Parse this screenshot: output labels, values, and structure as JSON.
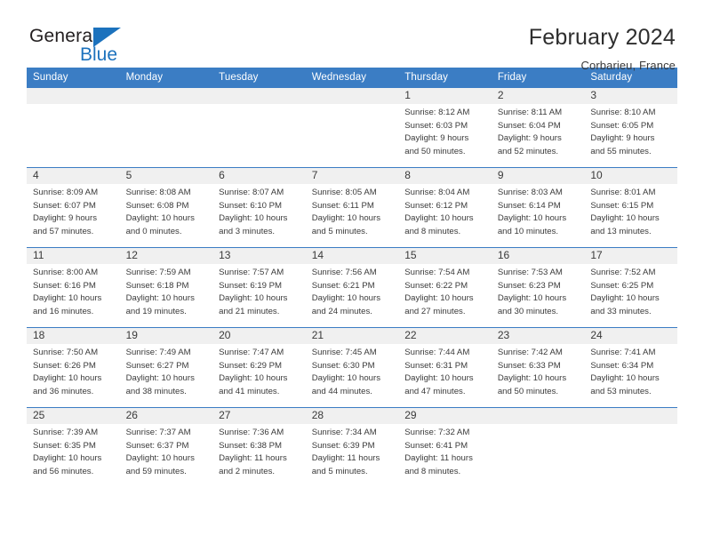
{
  "logo": {
    "word_general": "General",
    "word_blue": "Blue",
    "triangle": "blue-triangle",
    "brand_color": "#1c72bd"
  },
  "header": {
    "title": "February 2024",
    "location": "Corbarieu, France"
  },
  "theme": {
    "header_blue": "#3b7dc4",
    "daynum_band": "#f0f0f0",
    "text": "#3a3a3a"
  },
  "weekdays": [
    "Sunday",
    "Monday",
    "Tuesday",
    "Wednesday",
    "Thursday",
    "Friday",
    "Saturday"
  ],
  "weeks": [
    [
      {
        "day": "",
        "empty": true,
        "sunrise": "",
        "sunset": "",
        "daylight1": "",
        "daylight2": ""
      },
      {
        "day": "",
        "empty": true,
        "sunrise": "",
        "sunset": "",
        "daylight1": "",
        "daylight2": ""
      },
      {
        "day": "",
        "empty": true,
        "sunrise": "",
        "sunset": "",
        "daylight1": "",
        "daylight2": ""
      },
      {
        "day": "",
        "empty": true,
        "sunrise": "",
        "sunset": "",
        "daylight1": "",
        "daylight2": ""
      },
      {
        "day": "1",
        "empty": false,
        "sunrise": "Sunrise: 8:12 AM",
        "sunset": "Sunset: 6:03 PM",
        "daylight1": "Daylight: 9 hours",
        "daylight2": "and 50 minutes."
      },
      {
        "day": "2",
        "empty": false,
        "sunrise": "Sunrise: 8:11 AM",
        "sunset": "Sunset: 6:04 PM",
        "daylight1": "Daylight: 9 hours",
        "daylight2": "and 52 minutes."
      },
      {
        "day": "3",
        "empty": false,
        "sunrise": "Sunrise: 8:10 AM",
        "sunset": "Sunset: 6:05 PM",
        "daylight1": "Daylight: 9 hours",
        "daylight2": "and 55 minutes."
      }
    ],
    [
      {
        "day": "4",
        "empty": false,
        "sunrise": "Sunrise: 8:09 AM",
        "sunset": "Sunset: 6:07 PM",
        "daylight1": "Daylight: 9 hours",
        "daylight2": "and 57 minutes."
      },
      {
        "day": "5",
        "empty": false,
        "sunrise": "Sunrise: 8:08 AM",
        "sunset": "Sunset: 6:08 PM",
        "daylight1": "Daylight: 10 hours",
        "daylight2": "and 0 minutes."
      },
      {
        "day": "6",
        "empty": false,
        "sunrise": "Sunrise: 8:07 AM",
        "sunset": "Sunset: 6:10 PM",
        "daylight1": "Daylight: 10 hours",
        "daylight2": "and 3 minutes."
      },
      {
        "day": "7",
        "empty": false,
        "sunrise": "Sunrise: 8:05 AM",
        "sunset": "Sunset: 6:11 PM",
        "daylight1": "Daylight: 10 hours",
        "daylight2": "and 5 minutes."
      },
      {
        "day": "8",
        "empty": false,
        "sunrise": "Sunrise: 8:04 AM",
        "sunset": "Sunset: 6:12 PM",
        "daylight1": "Daylight: 10 hours",
        "daylight2": "and 8 minutes."
      },
      {
        "day": "9",
        "empty": false,
        "sunrise": "Sunrise: 8:03 AM",
        "sunset": "Sunset: 6:14 PM",
        "daylight1": "Daylight: 10 hours",
        "daylight2": "and 10 minutes."
      },
      {
        "day": "10",
        "empty": false,
        "sunrise": "Sunrise: 8:01 AM",
        "sunset": "Sunset: 6:15 PM",
        "daylight1": "Daylight: 10 hours",
        "daylight2": "and 13 minutes."
      }
    ],
    [
      {
        "day": "11",
        "empty": false,
        "sunrise": "Sunrise: 8:00 AM",
        "sunset": "Sunset: 6:16 PM",
        "daylight1": "Daylight: 10 hours",
        "daylight2": "and 16 minutes."
      },
      {
        "day": "12",
        "empty": false,
        "sunrise": "Sunrise: 7:59 AM",
        "sunset": "Sunset: 6:18 PM",
        "daylight1": "Daylight: 10 hours",
        "daylight2": "and 19 minutes."
      },
      {
        "day": "13",
        "empty": false,
        "sunrise": "Sunrise: 7:57 AM",
        "sunset": "Sunset: 6:19 PM",
        "daylight1": "Daylight: 10 hours",
        "daylight2": "and 21 minutes."
      },
      {
        "day": "14",
        "empty": false,
        "sunrise": "Sunrise: 7:56 AM",
        "sunset": "Sunset: 6:21 PM",
        "daylight1": "Daylight: 10 hours",
        "daylight2": "and 24 minutes."
      },
      {
        "day": "15",
        "empty": false,
        "sunrise": "Sunrise: 7:54 AM",
        "sunset": "Sunset: 6:22 PM",
        "daylight1": "Daylight: 10 hours",
        "daylight2": "and 27 minutes."
      },
      {
        "day": "16",
        "empty": false,
        "sunrise": "Sunrise: 7:53 AM",
        "sunset": "Sunset: 6:23 PM",
        "daylight1": "Daylight: 10 hours",
        "daylight2": "and 30 minutes."
      },
      {
        "day": "17",
        "empty": false,
        "sunrise": "Sunrise: 7:52 AM",
        "sunset": "Sunset: 6:25 PM",
        "daylight1": "Daylight: 10 hours",
        "daylight2": "and 33 minutes."
      }
    ],
    [
      {
        "day": "18",
        "empty": false,
        "sunrise": "Sunrise: 7:50 AM",
        "sunset": "Sunset: 6:26 PM",
        "daylight1": "Daylight: 10 hours",
        "daylight2": "and 36 minutes."
      },
      {
        "day": "19",
        "empty": false,
        "sunrise": "Sunrise: 7:49 AM",
        "sunset": "Sunset: 6:27 PM",
        "daylight1": "Daylight: 10 hours",
        "daylight2": "and 38 minutes."
      },
      {
        "day": "20",
        "empty": false,
        "sunrise": "Sunrise: 7:47 AM",
        "sunset": "Sunset: 6:29 PM",
        "daylight1": "Daylight: 10 hours",
        "daylight2": "and 41 minutes."
      },
      {
        "day": "21",
        "empty": false,
        "sunrise": "Sunrise: 7:45 AM",
        "sunset": "Sunset: 6:30 PM",
        "daylight1": "Daylight: 10 hours",
        "daylight2": "and 44 minutes."
      },
      {
        "day": "22",
        "empty": false,
        "sunrise": "Sunrise: 7:44 AM",
        "sunset": "Sunset: 6:31 PM",
        "daylight1": "Daylight: 10 hours",
        "daylight2": "and 47 minutes."
      },
      {
        "day": "23",
        "empty": false,
        "sunrise": "Sunrise: 7:42 AM",
        "sunset": "Sunset: 6:33 PM",
        "daylight1": "Daylight: 10 hours",
        "daylight2": "and 50 minutes."
      },
      {
        "day": "24",
        "empty": false,
        "sunrise": "Sunrise: 7:41 AM",
        "sunset": "Sunset: 6:34 PM",
        "daylight1": "Daylight: 10 hours",
        "daylight2": "and 53 minutes."
      }
    ],
    [
      {
        "day": "25",
        "empty": false,
        "sunrise": "Sunrise: 7:39 AM",
        "sunset": "Sunset: 6:35 PM",
        "daylight1": "Daylight: 10 hours",
        "daylight2": "and 56 minutes."
      },
      {
        "day": "26",
        "empty": false,
        "sunrise": "Sunrise: 7:37 AM",
        "sunset": "Sunset: 6:37 PM",
        "daylight1": "Daylight: 10 hours",
        "daylight2": "and 59 minutes."
      },
      {
        "day": "27",
        "empty": false,
        "sunrise": "Sunrise: 7:36 AM",
        "sunset": "Sunset: 6:38 PM",
        "daylight1": "Daylight: 11 hours",
        "daylight2": "and 2 minutes."
      },
      {
        "day": "28",
        "empty": false,
        "sunrise": "Sunrise: 7:34 AM",
        "sunset": "Sunset: 6:39 PM",
        "daylight1": "Daylight: 11 hours",
        "daylight2": "and 5 minutes."
      },
      {
        "day": "29",
        "empty": false,
        "sunrise": "Sunrise: 7:32 AM",
        "sunset": "Sunset: 6:41 PM",
        "daylight1": "Daylight: 11 hours",
        "daylight2": "and 8 minutes."
      },
      {
        "day": "",
        "empty": true,
        "sunrise": "",
        "sunset": "",
        "daylight1": "",
        "daylight2": ""
      },
      {
        "day": "",
        "empty": true,
        "sunrise": "",
        "sunset": "",
        "daylight1": "",
        "daylight2": ""
      }
    ]
  ]
}
